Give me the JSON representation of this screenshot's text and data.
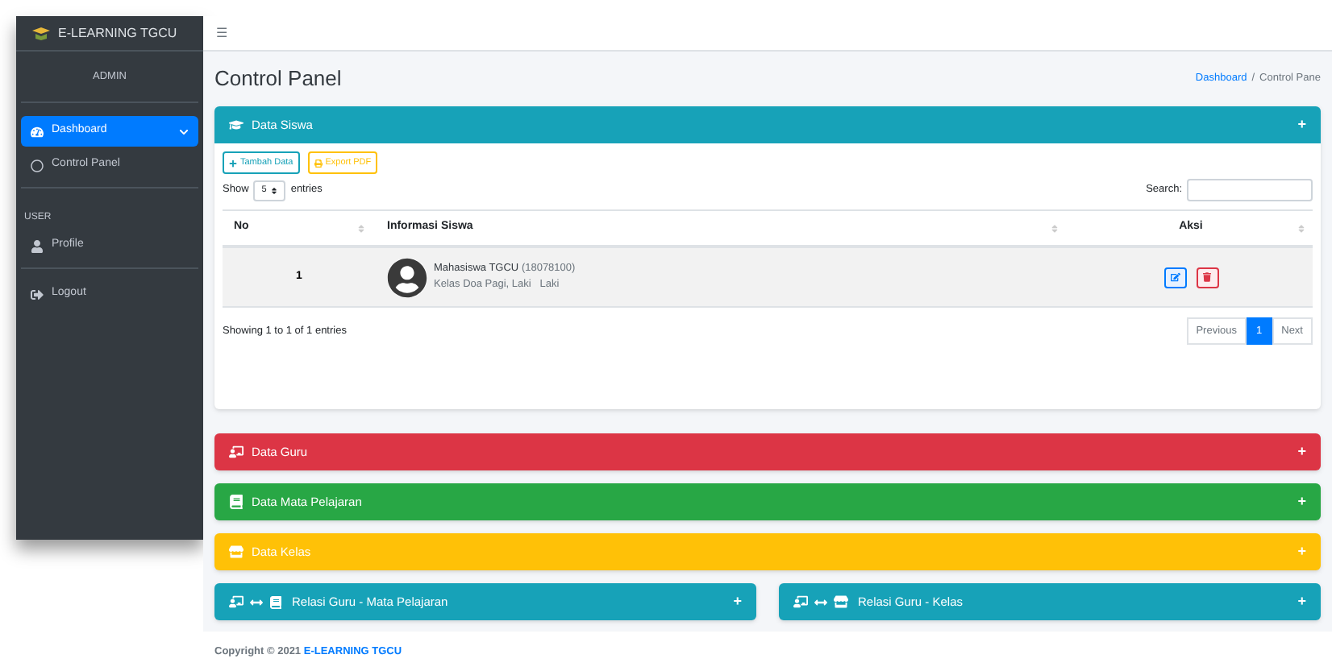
{
  "brand": "E-LEARNING TGCU",
  "sidebar": {
    "user": "ADMIN",
    "sections": [
      {
        "items": [
          {
            "label": "Dashboard",
            "selected": true,
            "expanded": true,
            "children": [
              {
                "label": "Control Panel",
                "selected": false
              }
            ]
          }
        ]
      },
      {
        "header": "USER",
        "items": [
          {
            "label": "Profile",
            "selected": false
          }
        ]
      },
      {
        "items": [
          {
            "label": "Logout",
            "selected": false
          }
        ]
      }
    ]
  },
  "topbar": {
    "menu": "☰"
  },
  "page_title": "Control Panel",
  "breadcrumb": {
    "separator": "/",
    "items": [
      {
        "label": "Dashboard",
        "link": true
      },
      {
        "label": "Control Pane",
        "link": false
      }
    ]
  },
  "siswa_card": {
    "title": "Data Siswa",
    "toggle": "+",
    "buttons": [
      {
        "kind": "add",
        "label": "Tambah Data"
      },
      {
        "kind": "pdf",
        "label": "Export PDF"
      }
    ],
    "length": {
      "before": "Show",
      "value": "5",
      "after": "entries"
    },
    "search_label": "Search:",
    "columns": [
      {
        "label": "No"
      },
      {
        "label": "Informasi Siswa"
      },
      {
        "label": "Aksi"
      }
    ],
    "rows": [
      {
        "no": "1",
        "name": "Mahasiswa TGCU",
        "nim": "(18078100)",
        "detail": "Kelas Doa Pagi, Laki   Laki"
      }
    ],
    "info": "Showing 1 to 1 of 1 entries",
    "pagination": [
      {
        "label": "Previous",
        "selected": false
      },
      {
        "label": "1",
        "selected": true
      },
      {
        "label": "Next",
        "selected": false
      }
    ]
  },
  "panels": [
    {
      "title": "Data Guru",
      "color": "#dc3545",
      "toggle": "+"
    },
    {
      "title": "Data Mata Pelajaran",
      "color": "#28a745",
      "toggle": "+"
    },
    {
      "title": "Data Kelas",
      "color": "#ffc107",
      "toggle": "+"
    }
  ],
  "relation_panels": [
    {
      "title": "Relasi Guru - Mata Pelajaran",
      "color": "#17a2b8",
      "toggle": "+"
    },
    {
      "title": "Relasi Guru - Kelas",
      "color": "#17a2b8",
      "toggle": "+"
    }
  ],
  "footer": {
    "text": "Copyright © 2021",
    "link": "E-LEARNING TGCU"
  }
}
